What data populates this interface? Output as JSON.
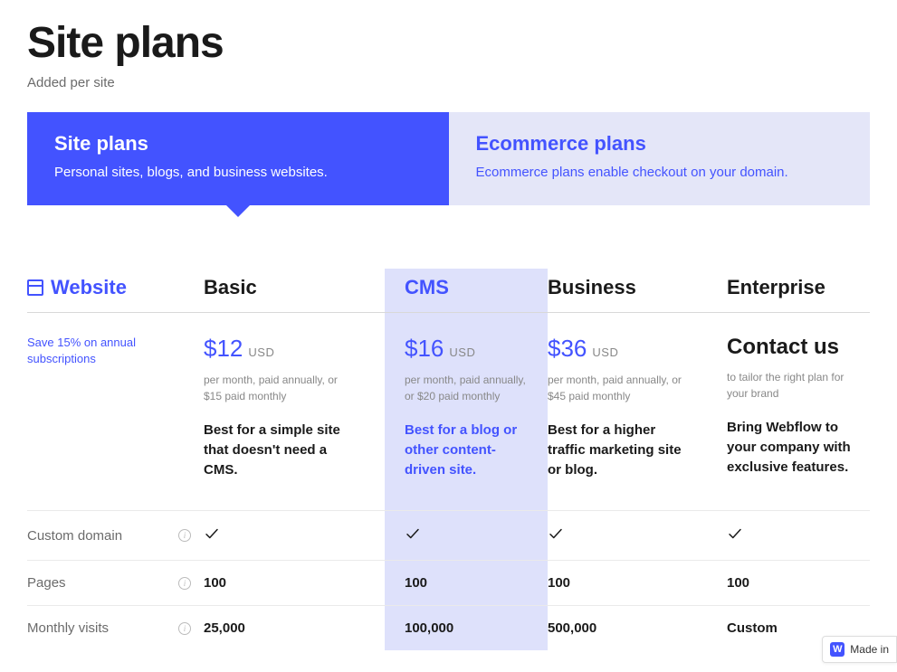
{
  "page": {
    "title": "Site plans",
    "subtitle": "Added per site"
  },
  "tabs": {
    "site_plans": {
      "title": "Site plans",
      "desc": "Personal sites, blogs, and business websites."
    },
    "ecommerce": {
      "title": "Ecommerce plans",
      "desc": "Ecommerce plans enable checkout on your domain."
    }
  },
  "category_label": "Website",
  "annual_note": "Save 15% on annual subscriptions",
  "plans": {
    "basic": {
      "name": "Basic",
      "price": "$12",
      "currency": "USD",
      "note": "per month, paid annually, or $15 paid monthly",
      "tagline": "Best for a simple site that doesn't need a CMS."
    },
    "cms": {
      "name": "CMS",
      "price": "$16",
      "currency": "USD",
      "note": "per month, paid annually, or $20 paid monthly",
      "tagline": "Best for a blog or other content-driven site."
    },
    "business": {
      "name": "Business",
      "price": "$36",
      "currency": "USD",
      "note": "per month, paid annually, or $45 paid monthly",
      "tagline": "Best for a higher traffic marketing site or blog."
    },
    "enterprise": {
      "name": "Enterprise",
      "contact": "Contact us",
      "note": "to tailor the right plan for your brand",
      "tagline": "Bring Webflow to your company with exclusive features."
    }
  },
  "features": {
    "custom_domain": {
      "label": "Custom domain",
      "basic": "✓",
      "cms": "✓",
      "business": "✓",
      "enterprise": "✓"
    },
    "pages": {
      "label": "Pages",
      "basic": "100",
      "cms": "100",
      "business": "100",
      "enterprise": "100"
    },
    "monthly_visits": {
      "label": "Monthly visits",
      "basic": "25,000",
      "cms": "100,000",
      "business": "500,000",
      "enterprise": "Custom"
    }
  },
  "badge": {
    "label": "Made in",
    "icon_letter": "W"
  }
}
